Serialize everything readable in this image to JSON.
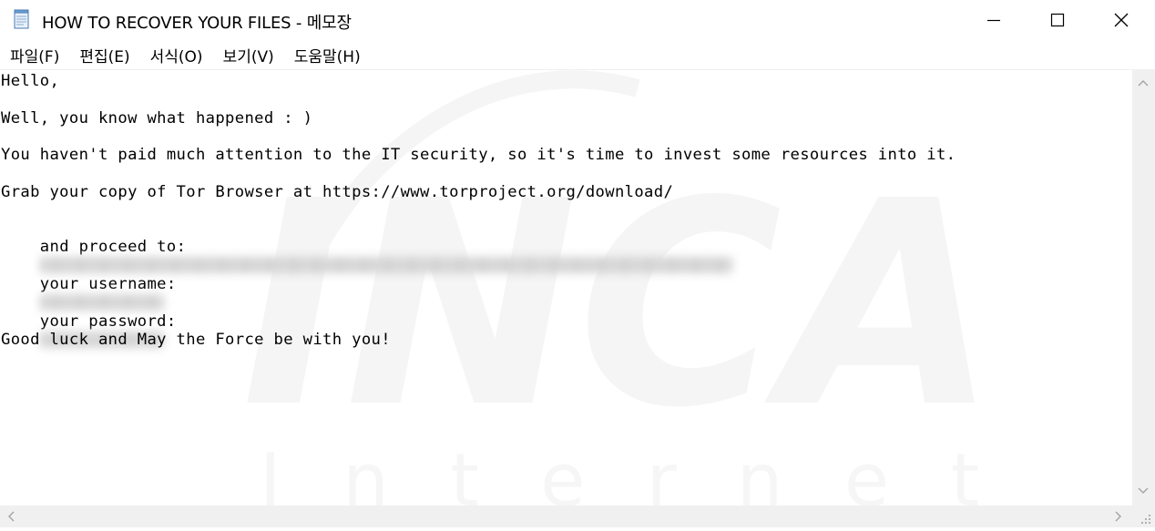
{
  "window": {
    "title": "HOW TO RECOVER YOUR FILES - 메모장",
    "icon": "notepad-icon",
    "controls": [
      "minimize-icon",
      "maximize-icon",
      "close-icon"
    ]
  },
  "menu": {
    "items": [
      "파일(F)",
      "편집(E)",
      "서식(O)",
      "보기(V)",
      "도움말(H)"
    ]
  },
  "document": {
    "line1": "Hello,",
    "line2": "Well, you know what happened : )",
    "line3": "You haven't paid much attention to the IT security, so it's time to invest some resources into it.",
    "line4": "Grab your copy of Tor Browser at https://www.torproject.org/download/",
    "line5_label": "and proceed to:",
    "line6_label": "your username:",
    "line7_label": "your password:",
    "line8": "Good luck and May the Force be with you!"
  },
  "watermark": {
    "logo_text": "INCA",
    "sub_text": "Internet"
  },
  "colors": {
    "background": "#ffffff",
    "scrollbar": "#f0f0f0",
    "text": "#000000",
    "watermark": "#f4f4f4"
  }
}
